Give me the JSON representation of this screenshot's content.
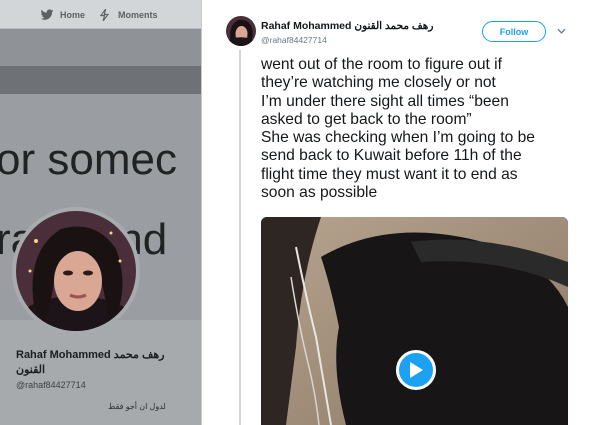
{
  "nav": {
    "home_label": "Home",
    "moments_label": "Moments"
  },
  "background": {
    "banner_line1": "or somec",
    "banner_line2": "rave and",
    "profile_name": "Rahaf Mohammed رهف محمد القنون",
    "profile_handle": "@rahaf84427714",
    "profile_bio": "لدول ان أجو فقط"
  },
  "tweet": {
    "author_name": "Rahaf Mohammed رهف محمد القنون",
    "author_handle": "@rahaf84427714",
    "follow_label": "Follow",
    "lines": [
      "went out of the room to figure out if",
      "they’re watching me closely or not",
      "I’m under there sight all times  “been",
      "asked to get back to the room”",
      "She was checking when I’m going to be",
      "send back to Kuwait before 11h of the",
      "flight time they must want it to end as",
      "soon as possible"
    ]
  },
  "colors": {
    "accent": "#1da1f2",
    "text": "#14171a",
    "secondary": "#657786"
  },
  "icons": {
    "home": "home-bird-icon",
    "moments": "lightning-icon",
    "play": "play-icon",
    "chevron": "chevron-down-icon"
  }
}
